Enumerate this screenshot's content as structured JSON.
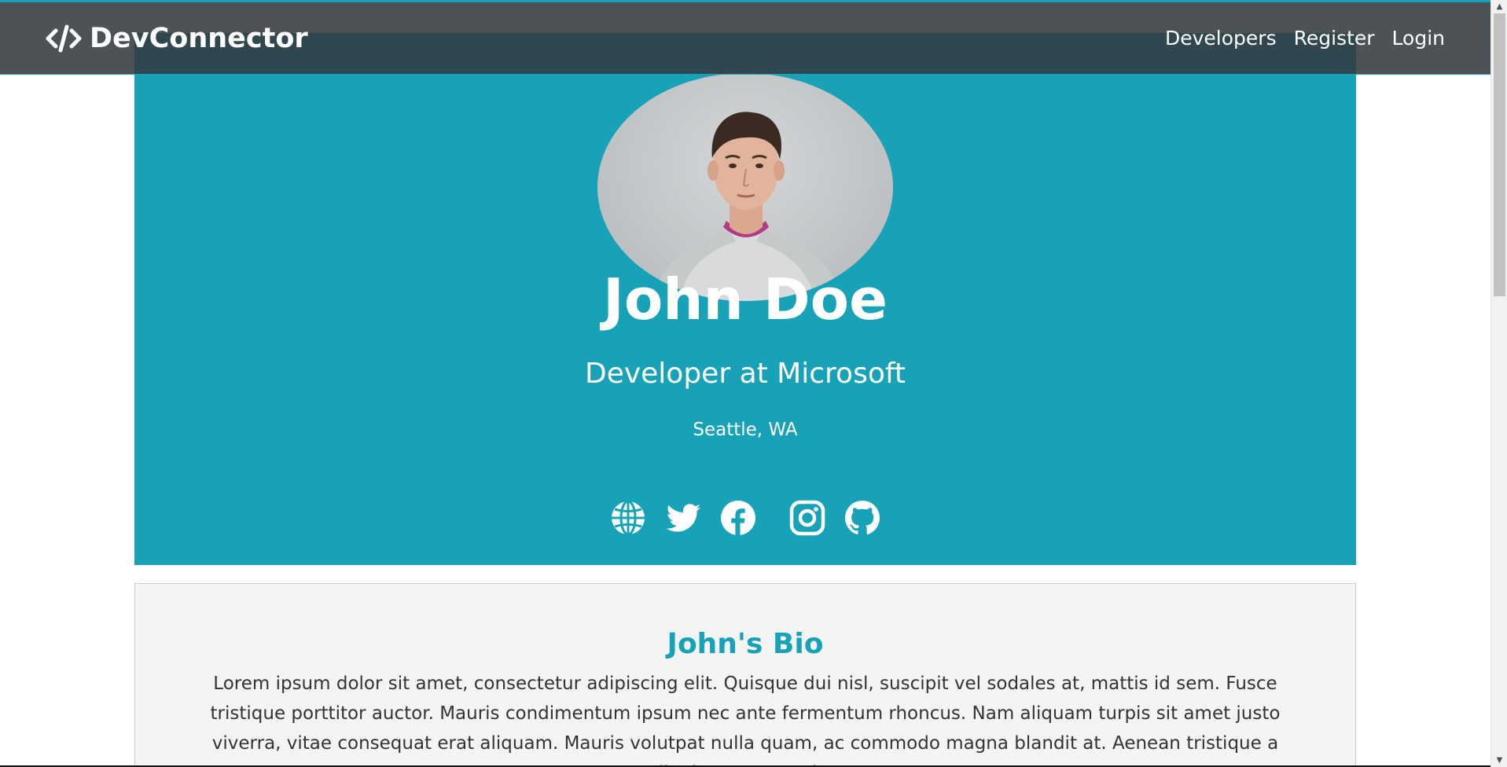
{
  "navbar": {
    "brand_text": "DevConnector",
    "links": [
      {
        "label": "Developers"
      },
      {
        "label": "Register"
      },
      {
        "label": "Login"
      }
    ]
  },
  "profile": {
    "name": "John Doe",
    "title": "Developer at Microsoft",
    "location": "Seattle, WA",
    "social_icons": [
      "globe-icon",
      "twitter-icon",
      "facebook-icon",
      "instagram-icon",
      "github-icon"
    ]
  },
  "bio": {
    "heading": "John's Bio",
    "text": "Lorem ipsum dolor sit amet, consectetur adipiscing elit. Quisque dui nisl, suscipit vel sodales at, mattis id sem. Fusce tristique porttitor auctor. Mauris condimentum ipsum nec ante fermentum rhoncus. Nam aliquam turpis sit amet justo viverra, vitae consequat erat aliquam. Mauris volutpat nulla quam, ac commodo magna blandit at. Aenean tristique a ligula ut venenatis."
  },
  "colors": {
    "primary": "#17a2b8",
    "navbar": "#343a40",
    "light": "#f4f4f4"
  }
}
